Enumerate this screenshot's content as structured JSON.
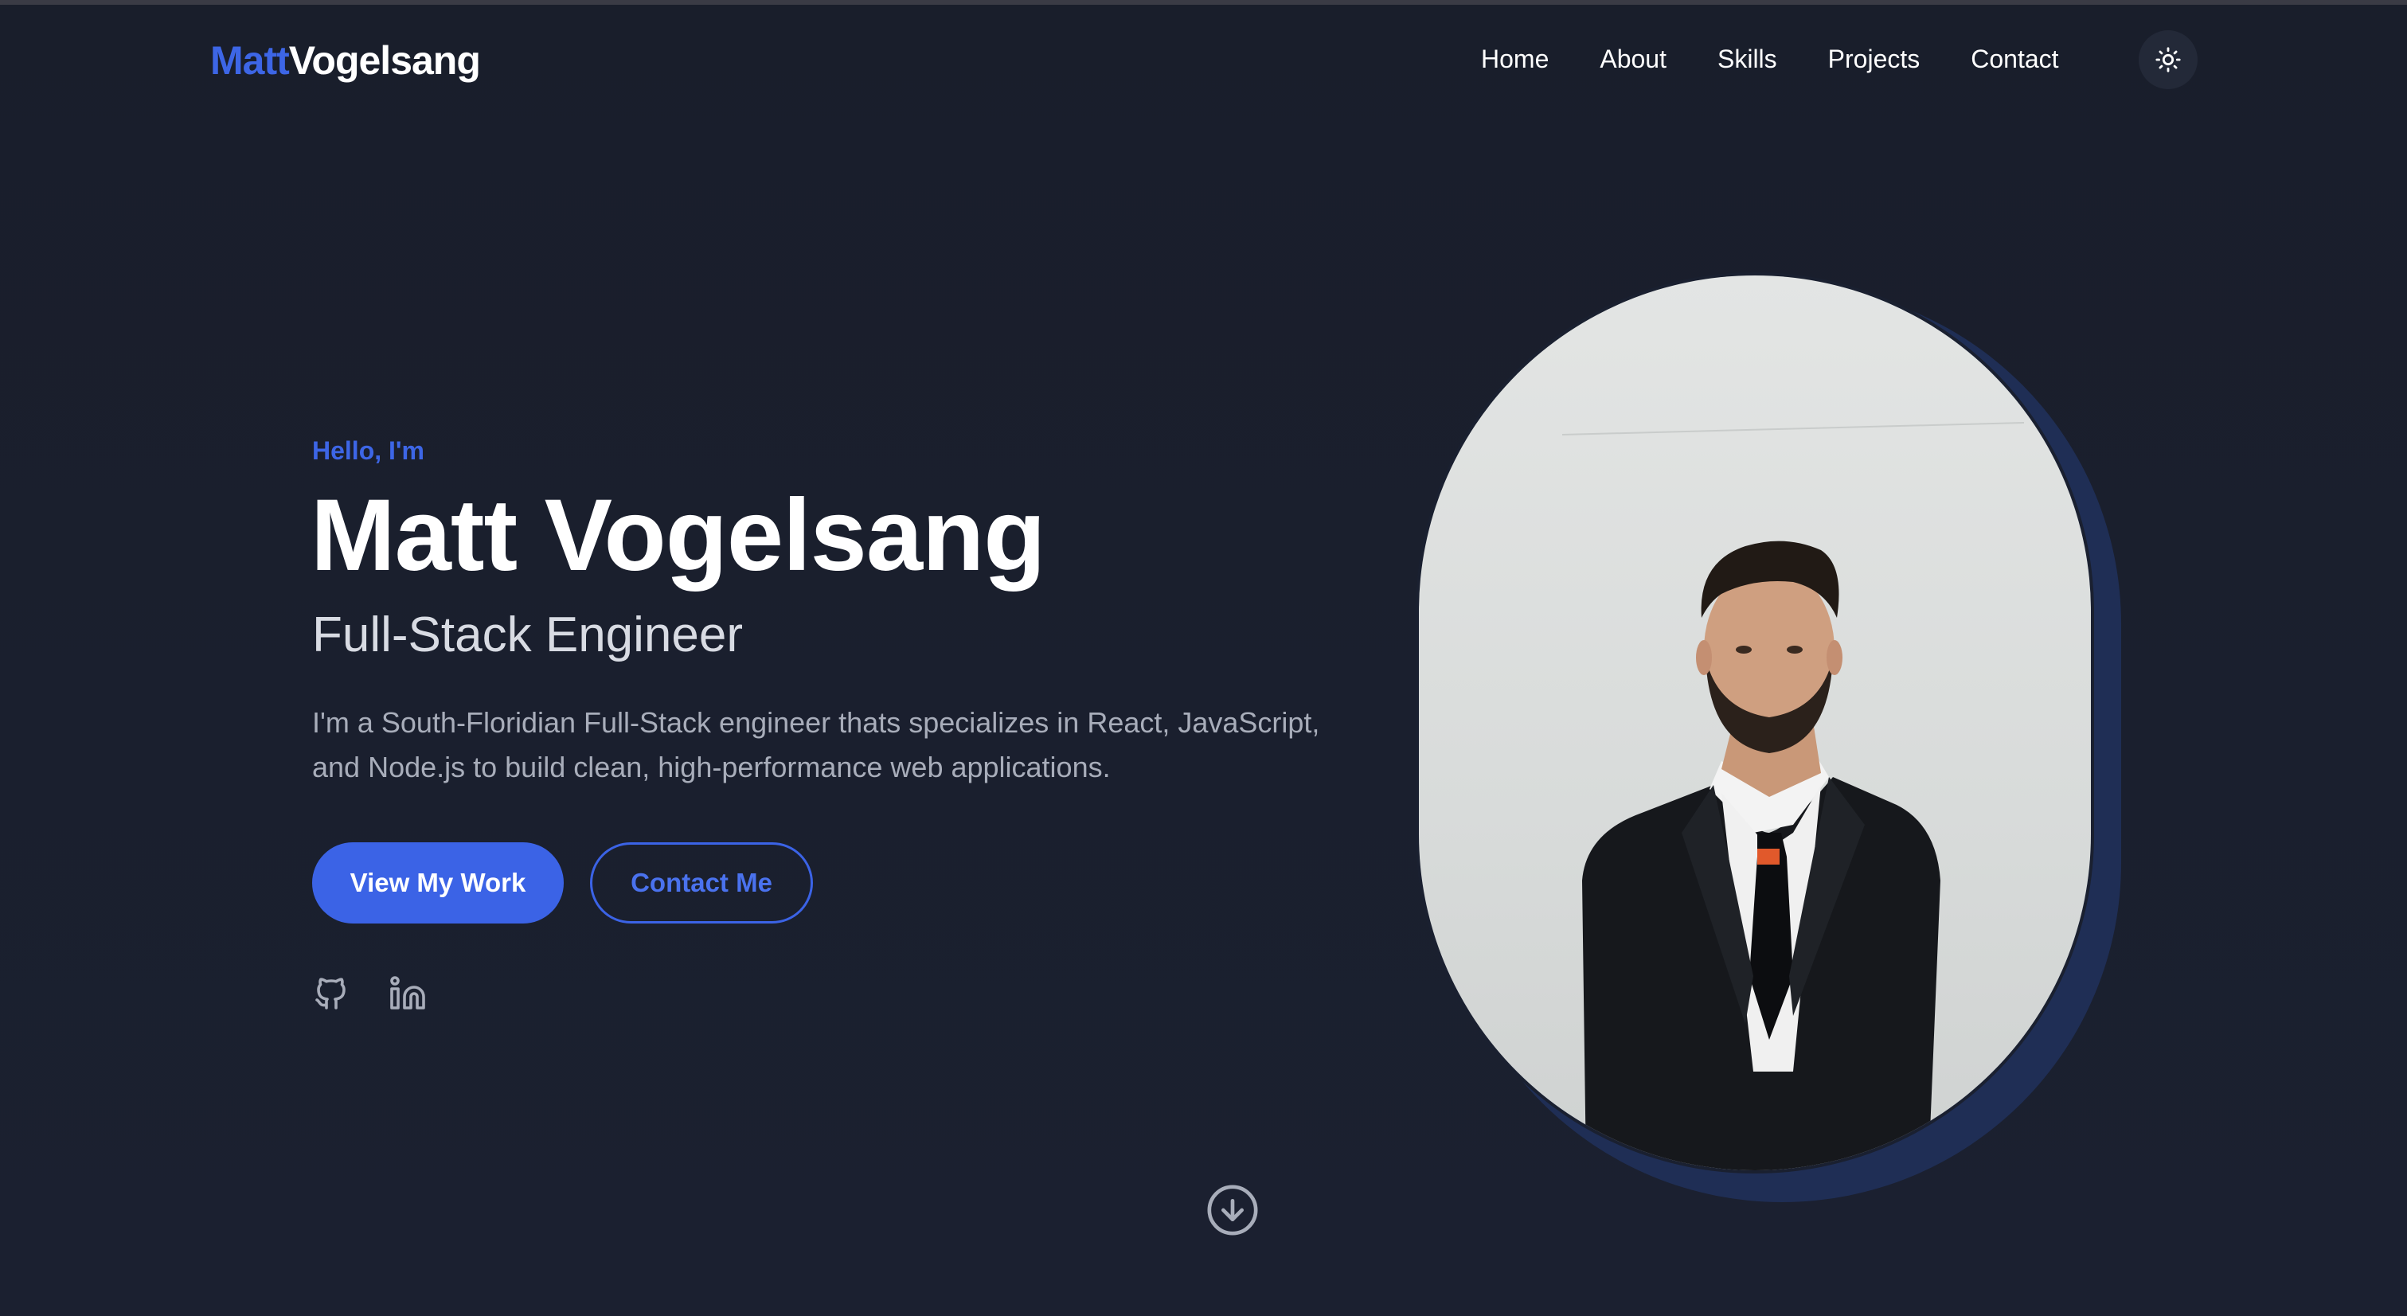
{
  "brand": {
    "first": "Matt",
    "last": "Vogelsang"
  },
  "nav": {
    "items": [
      {
        "label": "Home"
      },
      {
        "label": "About"
      },
      {
        "label": "Skills"
      },
      {
        "label": "Projects"
      },
      {
        "label": "Contact"
      }
    ],
    "theme_toggle_icon": "sun-icon"
  },
  "hero": {
    "greeting": "Hello, I'm",
    "name": "Matt Vogelsang",
    "role": "Full-Stack Engineer",
    "description": "I'm a South-Floridian Full-Stack engineer thats specializes in React, JavaScript, and Node.js to build clean, high-performance web applications.",
    "primary_button": "View My Work",
    "secondary_button": "Contact Me",
    "social": [
      "github-icon",
      "linkedin-icon"
    ],
    "scroll_icon": "arrow-down-circle-icon"
  },
  "colors": {
    "accent": "#3b63e6",
    "background": "#1a1f2c",
    "text": "#ffffff",
    "muted": "#a8adba"
  }
}
